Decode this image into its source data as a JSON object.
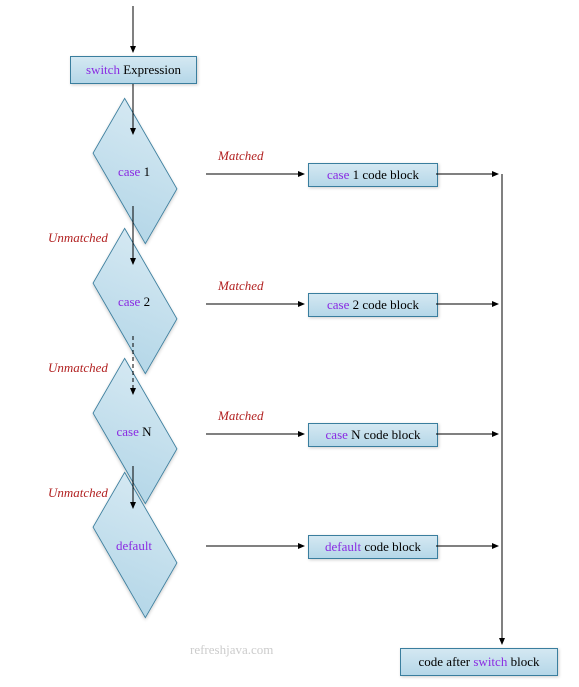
{
  "start": {
    "keyword": "switch",
    "rest": " Expression"
  },
  "cases": [
    {
      "keyword": "case",
      "num": " 1",
      "block_keyword": "case",
      "block_rest": " 1 code block"
    },
    {
      "keyword": "case",
      "num": " 2",
      "block_keyword": "case",
      "block_rest": " 2 code block"
    },
    {
      "keyword": "case",
      "num": " N",
      "block_keyword": "case",
      "block_rest": " N code block"
    }
  ],
  "default": {
    "keyword": "default",
    "block_keyword": "default",
    "block_rest": " code block"
  },
  "labels": {
    "matched": "Matched",
    "unmatched": "Unmatched"
  },
  "end": {
    "pre": "code after ",
    "keyword": "switch",
    "post": " block"
  },
  "watermark": "refreshjava.com"
}
